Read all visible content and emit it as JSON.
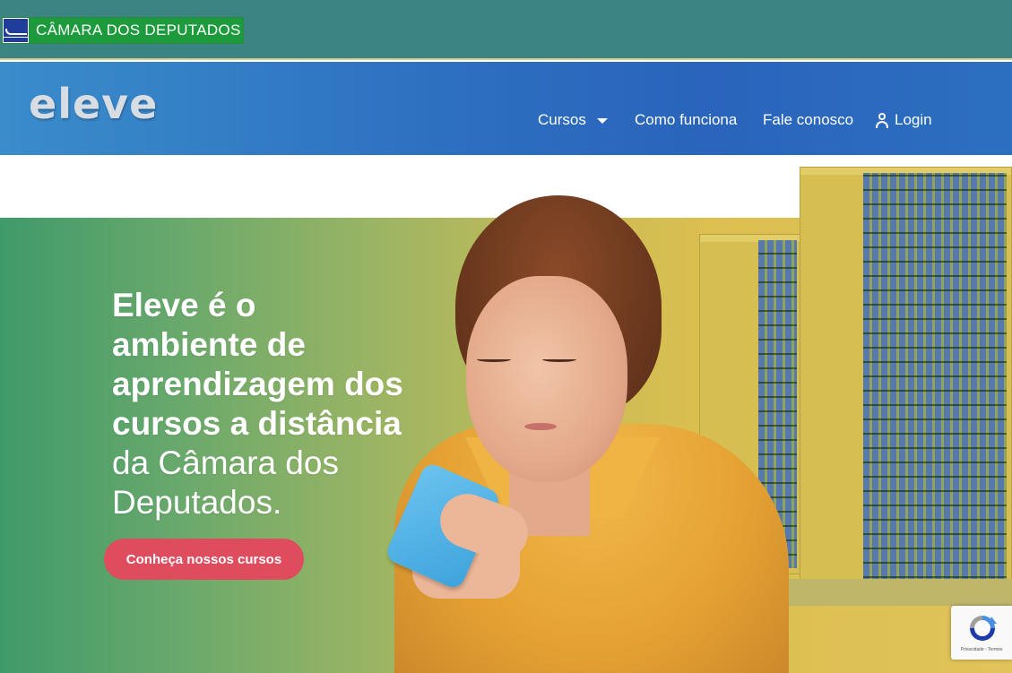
{
  "gov_bar": {
    "badge_text": "CÂMARA DOS DEPUTADOS",
    "flag_icon": "camara-flag-icon"
  },
  "header": {
    "logo_text": "eleve",
    "nav": [
      {
        "label": "Cursos",
        "has_dropdown": true
      },
      {
        "label": "Como funciona"
      },
      {
        "label": "Fale conosco"
      },
      {
        "label": "Login",
        "icon": "user-icon"
      }
    ]
  },
  "hero": {
    "title_bold_lines": [
      "Eleve é o",
      "ambiente de",
      "aprendizagem dos",
      "cursos a distância"
    ],
    "title_light_lines": [
      "da Câmara dos",
      "Deputados."
    ],
    "cta_label": "Conheça nossos cursos"
  },
  "recaptcha": {
    "footer_text": "Privacidade - Termos"
  },
  "colors": {
    "gov_bar": "#3c8483",
    "gov_badge_green": "#1c9a3c",
    "nav_blue": "#2d6fc0",
    "cta_red": "#de4c5e"
  }
}
